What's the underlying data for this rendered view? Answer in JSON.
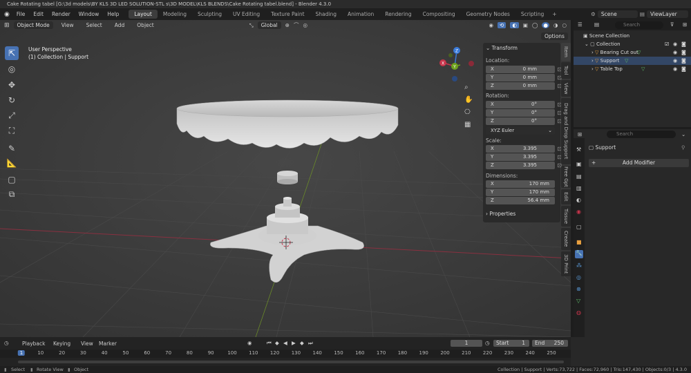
{
  "window": {
    "title": "Cake Rotating tabel [G:\\3d models\\BY KLS 3D LED SOLUTION-STL s\\3D MODEL\\KLS BLENDS\\Cake Rotating tabel.blend] - Blender 4.3.0"
  },
  "menus": [
    "File",
    "Edit",
    "Render",
    "Window",
    "Help"
  ],
  "workspaces": [
    "Layout",
    "Modeling",
    "Sculpting",
    "UV Editing",
    "Texture Paint",
    "Shading",
    "Animation",
    "Rendering",
    "Compositing",
    "Geometry Nodes",
    "Scripting"
  ],
  "active_workspace": "Layout",
  "scene": {
    "scene_name": "Scene",
    "view_layer": "ViewLayer"
  },
  "viewport_header": {
    "mode": "Object Mode",
    "menus": [
      "View",
      "Select",
      "Add",
      "Object"
    ],
    "orientation": "Global",
    "options": "Options"
  },
  "viewport": {
    "view_name": "User Perspective",
    "collection_info": "(1) Collection | Support"
  },
  "gizmo": {
    "x": "X",
    "y": "Y",
    "z": "Z"
  },
  "npanel": {
    "transform_header": "Transform",
    "location_label": "Location:",
    "location": [
      {
        "axis": "X",
        "value": "0 mm"
      },
      {
        "axis": "Y",
        "value": "0 mm"
      },
      {
        "axis": "Z",
        "value": "0 mm"
      }
    ],
    "rotation_label": "Rotation:",
    "rotation": [
      {
        "axis": "X",
        "value": "0°"
      },
      {
        "axis": "Y",
        "value": "0°"
      },
      {
        "axis": "Z",
        "value": "0°"
      }
    ],
    "rotation_mode": "XYZ Euler",
    "scale_label": "Scale:",
    "scale": [
      {
        "axis": "X",
        "value": "3.395"
      },
      {
        "axis": "Y",
        "value": "3.395"
      },
      {
        "axis": "Z",
        "value": "3.395"
      }
    ],
    "dimensions_label": "Dimensions:",
    "dimensions": [
      {
        "axis": "X",
        "value": "170 mm"
      },
      {
        "axis": "Y",
        "value": "170 mm"
      },
      {
        "axis": "Z",
        "value": "56.4 mm"
      }
    ],
    "properties_header": "Properties"
  },
  "side_tabs": [
    "Item",
    "Tool",
    "View",
    "Drag and Drop Support",
    "Free Gpt",
    "Edit",
    "Tissue",
    "Create",
    "3D Print"
  ],
  "outliner": {
    "search_placeholder": "Search",
    "scene_collection": "Scene Collection",
    "collection": "Collection",
    "objects": [
      "Bearing Cut out",
      "Support",
      "Table Top"
    ]
  },
  "properties": {
    "search_placeholder": "Search",
    "object_name": "Support",
    "add_modifier": "Add Modifier"
  },
  "timeline": {
    "menus": [
      "Playback",
      "Keying",
      "View",
      "Marker"
    ],
    "current_frame": "1",
    "start_label": "Start",
    "start": "1",
    "end_label": "End",
    "end": "250",
    "ruler": [
      "1",
      "10",
      "20",
      "30",
      "40",
      "50",
      "60",
      "70",
      "80",
      "90",
      "100",
      "110",
      "120",
      "130",
      "140",
      "150",
      "160",
      "170",
      "180",
      "190",
      "200",
      "210",
      "220",
      "230",
      "240",
      "250"
    ]
  },
  "statusbar": {
    "left": [
      "Select",
      "Rotate View",
      "Object"
    ],
    "right": "Collection | Support | Verts:73,722 | Faces:72,960 | Tris:147,430 | Objects:0/3 | 4.3.0"
  },
  "colors": {
    "accent": "#4772b3",
    "x_axis": "#c8344b",
    "y_axis": "#6fa21e",
    "z_axis": "#3a7ad8",
    "viewport_bg": "#3a3a3a"
  }
}
